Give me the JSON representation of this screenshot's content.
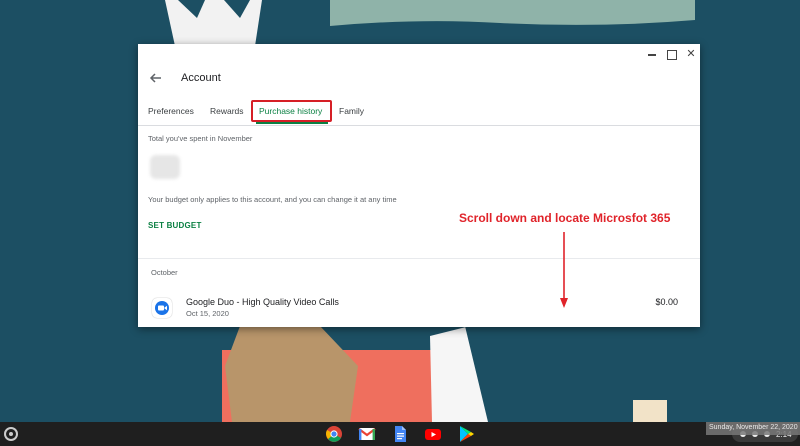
{
  "window": {
    "title": "Account"
  },
  "tabs": [
    {
      "label": "Preferences"
    },
    {
      "label": "Rewards"
    },
    {
      "label": "Purchase history",
      "selected": true
    },
    {
      "label": "Family"
    }
  ],
  "summary": {
    "spent_label": "Total you've spent in November",
    "budget_note": "Your budget only applies to this account, and you can change it at any time",
    "set_budget_label": "SET BUDGET"
  },
  "history": {
    "month": "October",
    "items": [
      {
        "name": "Google Duo - High Quality Video Calls",
        "date": "Oct 15, 2020",
        "price": "$0.00",
        "icon": "google-duo-icon"
      }
    ]
  },
  "annotation": {
    "text": "Scroll down and locate Microsfot 365",
    "color": "#e0232a"
  },
  "shelf": {
    "apps": [
      "chrome-icon",
      "gmail-icon",
      "docs-icon",
      "youtube-icon",
      "play-store-icon"
    ],
    "tooltip": "Sunday, November 22, 2020",
    "time": "2:14"
  },
  "colors": {
    "accent": "#0b8043",
    "highlight_box": "#d61f26",
    "wallpaper": "#1c4f63"
  }
}
